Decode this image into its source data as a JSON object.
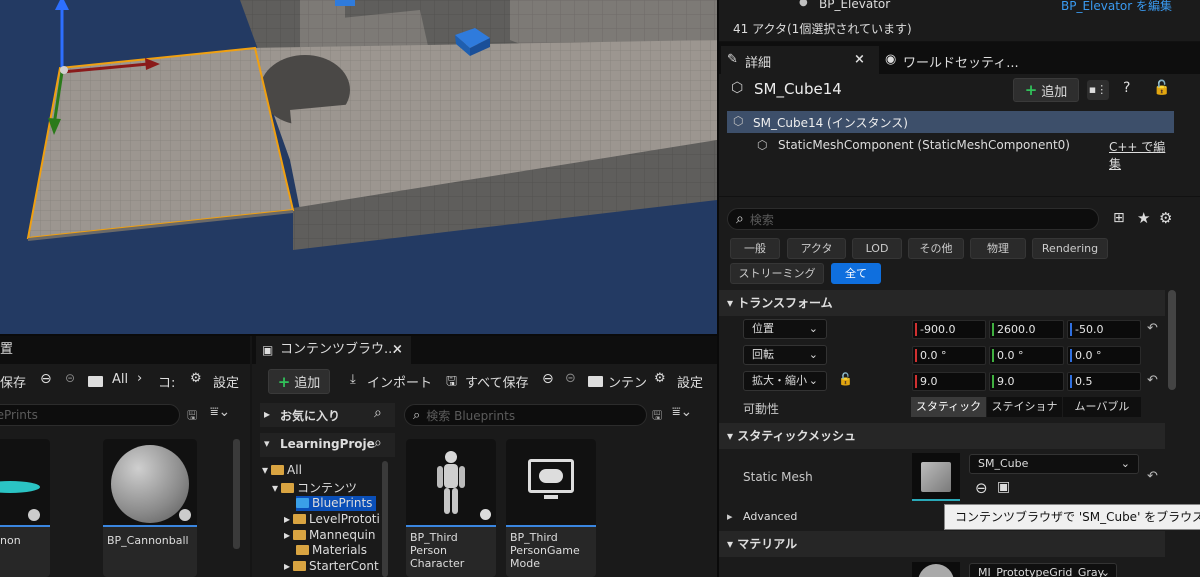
{
  "outliner": {
    "row_label": "BP_Elevator",
    "edit_link": "BP_Elevator を編集",
    "actor_count": "41 アクタ(1個選択されています)"
  },
  "details": {
    "tab_details": "詳細",
    "tab_world": "ワールドセッティ...",
    "tab_close": "×",
    "actor_name": "SM_Cube14",
    "add_button": "追加",
    "components": [
      {
        "label": "SM_Cube14 (インスタンス)"
      },
      {
        "label": "StaticMeshComponent (StaticMeshComponent0)",
        "link": "C++ で編集"
      }
    ],
    "search_placeholder": "検索",
    "filters": [
      "一般",
      "アクタ",
      "LOD",
      "その他",
      "物理",
      "Rendering",
      "ストリーミング",
      "全て"
    ],
    "filter_active": "全て",
    "sections": {
      "transform": "トランスフォーム",
      "static_mesh": "スタティックメッシュ",
      "advanced": "Advanced",
      "material": "マテリアル"
    },
    "transform": {
      "location": {
        "label": "位置",
        "x": "-900.0",
        "y": "2600.0",
        "z": "-50.0"
      },
      "rotation": {
        "label": "回転",
        "x": "0.0 °",
        "y": "0.0 °",
        "z": "0.0 °"
      },
      "scale": {
        "label": "拡大・縮小",
        "x": "9.0",
        "y": "9.0",
        "z": "0.5"
      },
      "mobility": {
        "label": "可動性",
        "options": [
          "スタティック",
          "ステイショナ",
          "ムーバブル"
        ],
        "selected": "スタティック"
      }
    },
    "static_mesh": {
      "label": "Static Mesh",
      "value": "SM_Cube"
    },
    "material": {
      "value": "MI_PrototypeGrid_Gray"
    },
    "tooltip": "コンテンツブラウザで 'SM_Cube' をブラウズ"
  },
  "left_panel": {
    "tab": "置",
    "save": "保存",
    "all": "All",
    "crumb": "コ:",
    "settings": "設定",
    "search_placeholder": "uePrints",
    "tiles": [
      {
        "label": "non"
      },
      {
        "label": "BP_Cannonball"
      }
    ]
  },
  "content_browser": {
    "tab": "コンテンツブラウ...",
    "tab_close": "×",
    "add": "追加",
    "import": "インポート",
    "save_all": "すべて保存",
    "all": "All",
    "crumb": "ンテン",
    "settings": "設定",
    "favorites": "お気に入り",
    "project": "LearningProje",
    "search_placeholder": "検索 Blueprints",
    "tree": [
      {
        "label": "All",
        "level": 0
      },
      {
        "label": "コンテンツ",
        "level": 1
      },
      {
        "label": "BluePrints",
        "level": 2
      },
      {
        "label": "LevelPrototi",
        "level": 2
      },
      {
        "label": "Mannequin",
        "level": 2
      },
      {
        "label": "Materials",
        "level": 2
      },
      {
        "label": "StarterCont",
        "level": 2
      }
    ],
    "assets": [
      {
        "label": "BP_Third Person Character"
      },
      {
        "label": "BP_Third PersonGame Mode"
      }
    ]
  }
}
